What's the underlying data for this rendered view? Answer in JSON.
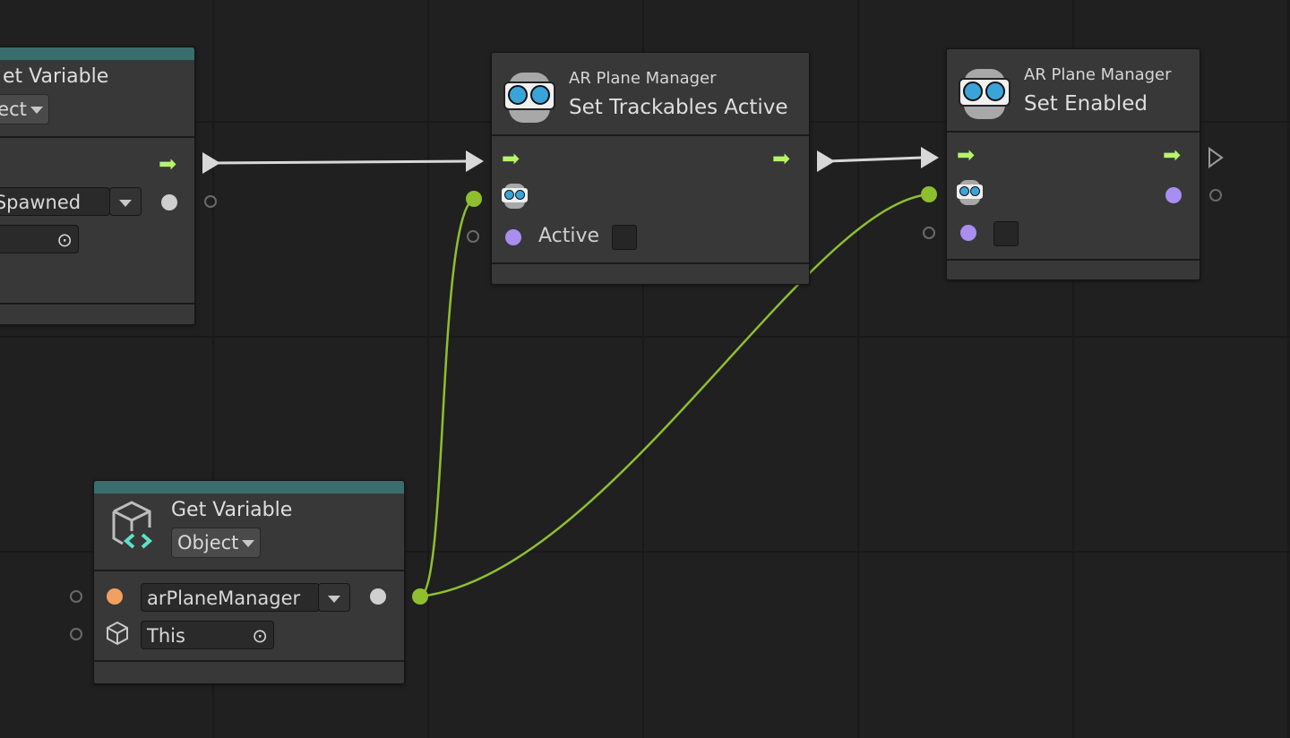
{
  "nodes": {
    "set_variable": {
      "title": "et Variable",
      "kind": "bject",
      "variable_name": "lSpawned"
    },
    "set_trackables_active": {
      "subtitle": "AR Plane Manager",
      "title": "Set Trackables Active",
      "active_label": "Active",
      "active_checked": false
    },
    "set_enabled": {
      "subtitle": "AR Plane Manager",
      "title": "Set Enabled",
      "enabled_checked": false
    },
    "get_variable": {
      "title": "Get Variable",
      "kind": "Object",
      "variable_name": "arPlaneManager",
      "target": "This"
    }
  },
  "colors": {
    "flow": "#b6f56a",
    "object_port": "#8fbf2f",
    "bool_port": "#a98ef0",
    "string_port": "#f2a061",
    "header_teal": "#3a6e6e"
  }
}
